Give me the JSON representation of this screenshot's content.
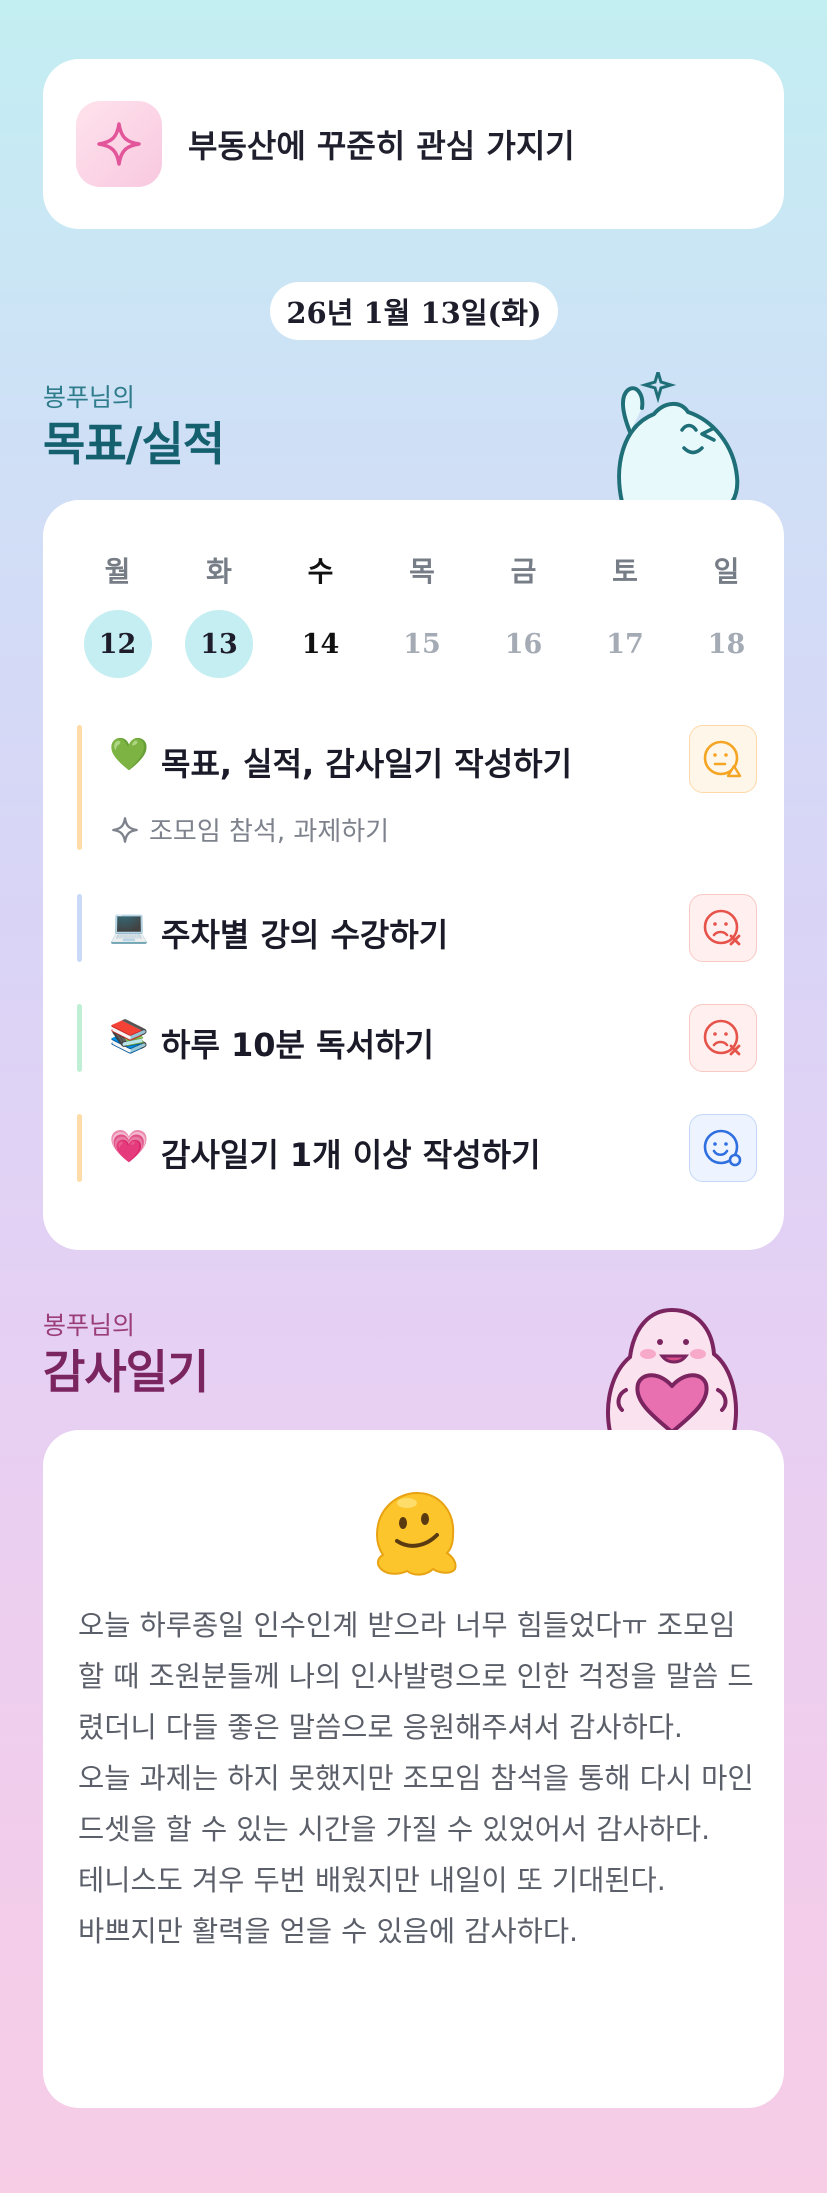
{
  "goal_banner": {
    "text": "부동산에 꾸준히 관심 가지기",
    "icon": "sparkle-icon"
  },
  "date": "26년 1월 13일(화)",
  "goals_section": {
    "subtitle": "봉푸님의",
    "title": "목표/실적"
  },
  "calendar": {
    "weekdays": [
      "월",
      "화",
      "수",
      "목",
      "금",
      "토",
      "일"
    ],
    "days": [
      "12",
      "13",
      "14",
      "15",
      "16",
      "17",
      "18"
    ]
  },
  "goals": [
    {
      "emoji": "💚",
      "label": "목표, 실적, 감사일기 작성하기",
      "sub": "조모임 참석, 과제하기",
      "bar_color": "#ffdca8",
      "status": "pending"
    },
    {
      "emoji": "💻",
      "label": "주차별 강의 수강하기",
      "bar_color": "#c9d9f7",
      "status": "failed"
    },
    {
      "emoji": "📚",
      "label": "하루 10분 독서하기",
      "bar_color": "#bff0d6",
      "status": "failed"
    },
    {
      "emoji": "💗",
      "label": "감사일기 1개 이상 작성하기",
      "bar_color": "#ffdca8",
      "status": "done"
    }
  ],
  "thanks_section": {
    "subtitle": "봉푸님의",
    "title": "감사일기"
  },
  "thanks": {
    "emoji": "🫠",
    "text": "오늘 하루종일 인수인계 받으라 너무 힘들었다ㅠ 조모임 할 때 조원분들께 나의 인사발령으로 인한 걱정을 말씀 드렸더니 다들 좋은 말씀으로 응원해주셔서 감사하다.\n오늘 과제는 하지 못했지만 조모임 참석을 통해 다시 마인드셋을 할 수 있는 시간을 가질 수 있었어서 감사하다.\n테니스도 겨우 두번 배웠지만 내일이 또 기대된다.\n바쁘지만 활력을 얻을 수 있음에 감사하다."
  },
  "colors": {
    "goal_title": "#14606f",
    "thanks_title": "#7b2560",
    "done_circle": "#c5eef2",
    "status_pending": "#f5a524",
    "status_failed": "#e5534b",
    "status_done": "#2f6fe0"
  }
}
